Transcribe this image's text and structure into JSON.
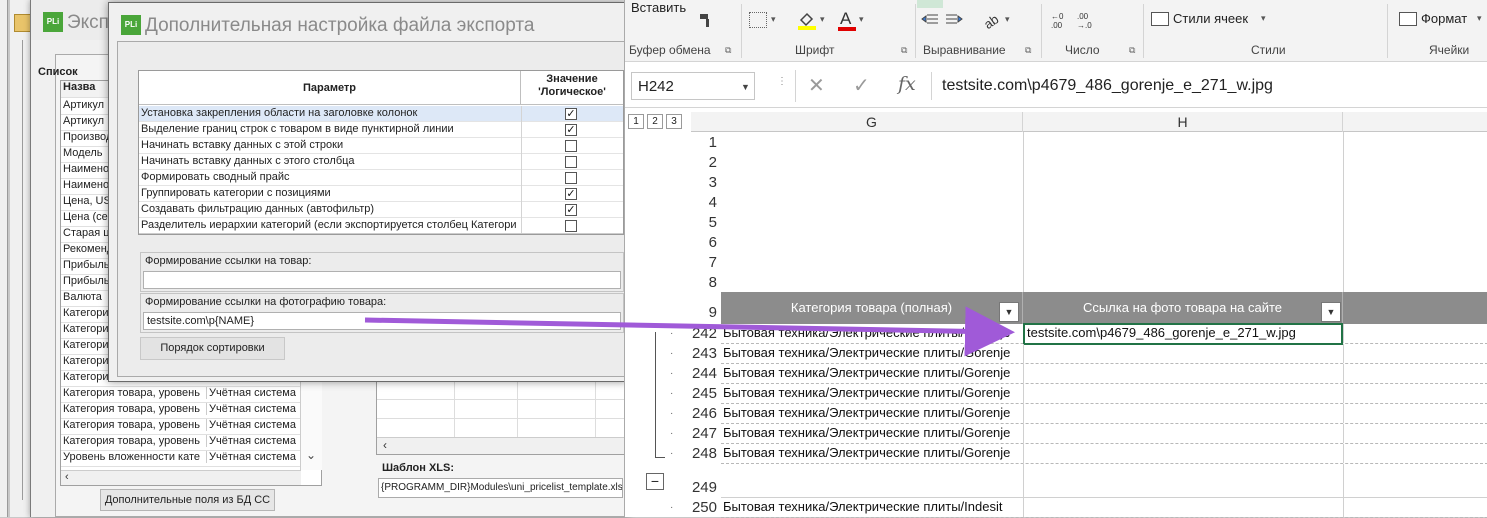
{
  "back_window": {
    "title": "Экспо",
    "logo": "PLi",
    "list_label": "Список",
    "header_col1": "Назва",
    "fields": [
      {
        "name": "Артикул",
        "source": ""
      },
      {
        "name": "Артикул",
        "source": ""
      },
      {
        "name": "Производ",
        "source": ""
      },
      {
        "name": "Модель",
        "source": ""
      },
      {
        "name": "Наименов",
        "source": ""
      },
      {
        "name": "Наименов",
        "source": ""
      },
      {
        "name": "Цена, US",
        "source": ""
      },
      {
        "name": "Цена (се",
        "source": ""
      },
      {
        "name": "Старая ц",
        "source": ""
      },
      {
        "name": "Рекоменд",
        "source": ""
      },
      {
        "name": "Прибыль",
        "source": ""
      },
      {
        "name": "Прибыль",
        "source": ""
      },
      {
        "name": "Валюта",
        "source": ""
      },
      {
        "name": "Категори",
        "source": ""
      },
      {
        "name": "Категори",
        "source": ""
      },
      {
        "name": "Категори",
        "source": ""
      },
      {
        "name": "Категори",
        "source": ""
      },
      {
        "name": "Категори",
        "source": ""
      },
      {
        "name": "Категория товара, уровень",
        "source": "Учётная система"
      },
      {
        "name": "Категория товара, уровень",
        "source": "Учётная система"
      },
      {
        "name": "Категория товара, уровень",
        "source": "Учётная система"
      },
      {
        "name": "Категория товара, уровень",
        "source": "Учётная система"
      },
      {
        "name": "Уровень вложенности кате",
        "source": "Учётная система"
      }
    ],
    "extra_fields_button": "Дополнительные поля из БД СС",
    "template_label": "Шаблон XLS:",
    "template_value": "{PROGRAMM_DIR}Modules\\uni_pricelist_template.xls"
  },
  "dialog": {
    "logo": "PLi",
    "title": "Дополнительная настройка файла экспорта",
    "col_param": "Параметр",
    "col_value": "Значение 'Логическое'",
    "params": [
      {
        "label": "Установка закрепления области на заголовке колонок",
        "checked": true,
        "selected": true
      },
      {
        "label": "Выделение границ строк с товаром в виде пунктирной линии",
        "checked": true,
        "selected": false
      },
      {
        "label": "Начинать вставку данных с этой строки",
        "checked": false,
        "selected": false
      },
      {
        "label": "Начинать вставку данных с этого столбца",
        "checked": false,
        "selected": false
      },
      {
        "label": "Формировать сводный прайс",
        "checked": false,
        "selected": false
      },
      {
        "label": "Группировать категории с позициями",
        "checked": true,
        "selected": false
      },
      {
        "label": "Создавать фильтрацию данных (автофильтр)",
        "checked": true,
        "selected": false
      },
      {
        "label": "Разделитель иерархии категорий (если экспортируется столбец Категори",
        "checked": false,
        "selected": false
      }
    ],
    "product_link_label": "Формирование ссылки на товар:",
    "product_link_value": "",
    "photo_link_label": "Формирование ссылки на фотографию товара:",
    "photo_link_value": "testsite.com\\p{NAME}",
    "sort_button": "Порядок сортировки"
  },
  "excel": {
    "ribbon": {
      "paste_label": "Вставить",
      "clipboard_group": "Буфер обмена",
      "font_group": "Шрифт",
      "alignment_group": "Выравнивание",
      "number_group": "Число",
      "styles_group": "Стили",
      "cells_group": "Ячейки",
      "cell_styles": "Стили ячеек",
      "format": "Формат"
    },
    "name_box": "H242",
    "formula": "testsite.com\\p4679_486_gorenje_e_271_w.jpg",
    "outline_levels": [
      "1",
      "2",
      "3"
    ],
    "columns": [
      "G",
      "H"
    ],
    "header_row": "9",
    "header_cells": [
      "Категория товара (полная)",
      "Ссылка на фото товара на сайте"
    ],
    "empty_rows": [
      "1",
      "2",
      "3",
      "4",
      "5",
      "6",
      "7",
      "8"
    ],
    "rows": [
      {
        "num": "242",
        "g": "Бытовая техника/Электрические плиты/Gorenje",
        "h": "testsite.com\\p4679_486_gorenje_e_271_w.jpg"
      },
      {
        "num": "243",
        "g": "Бытовая техника/Электрические плиты/Gorenje",
        "h": ""
      },
      {
        "num": "244",
        "g": "Бытовая техника/Электрические плиты/Gorenje",
        "h": ""
      },
      {
        "num": "245",
        "g": "Бытовая техника/Электрические плиты/Gorenje",
        "h": ""
      },
      {
        "num": "246",
        "g": "Бытовая техника/Электрические плиты/Gorenje",
        "h": ""
      },
      {
        "num": "247",
        "g": "Бытовая техника/Электрические плиты/Gorenje",
        "h": ""
      },
      {
        "num": "248",
        "g": "Бытовая техника/Электрические плиты/Gorenje",
        "h": ""
      },
      {
        "num": "249",
        "g": "",
        "h": ""
      },
      {
        "num": "250",
        "g": "Бытовая техника/Электрические плиты/Indesit",
        "h": ""
      }
    ],
    "arrow_color": "#a05ad8",
    "header_band_color": "#8c8c8c"
  }
}
